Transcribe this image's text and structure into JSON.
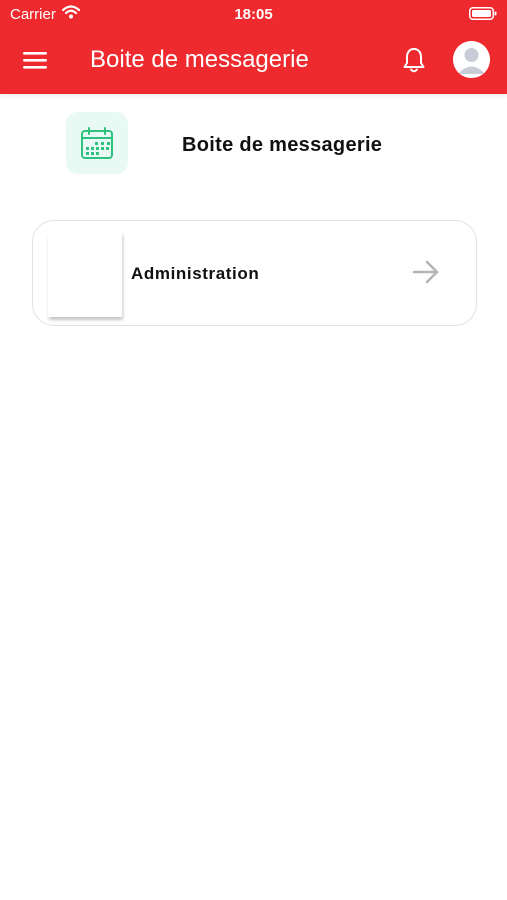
{
  "status_bar": {
    "carrier": "Carrier",
    "time": "18:05"
  },
  "header": {
    "title": "Boite de messagerie",
    "menu_icon": "hamburger-menu-icon",
    "bell_icon": "bell-icon",
    "avatar_icon": "user-avatar-icon"
  },
  "section": {
    "icon": "calendar-icon",
    "title": "Boite de messagerie"
  },
  "inbox": {
    "items": [
      {
        "label": "Administration",
        "arrow_icon": "arrow-right-icon"
      }
    ]
  },
  "colors": {
    "brand_red": "#ee2a2e",
    "accent_green": "#2ec27e",
    "icon_bg": "#e9faf5",
    "card_border": "#e2e2e2",
    "arrow_gray": "#b5b5b5"
  }
}
